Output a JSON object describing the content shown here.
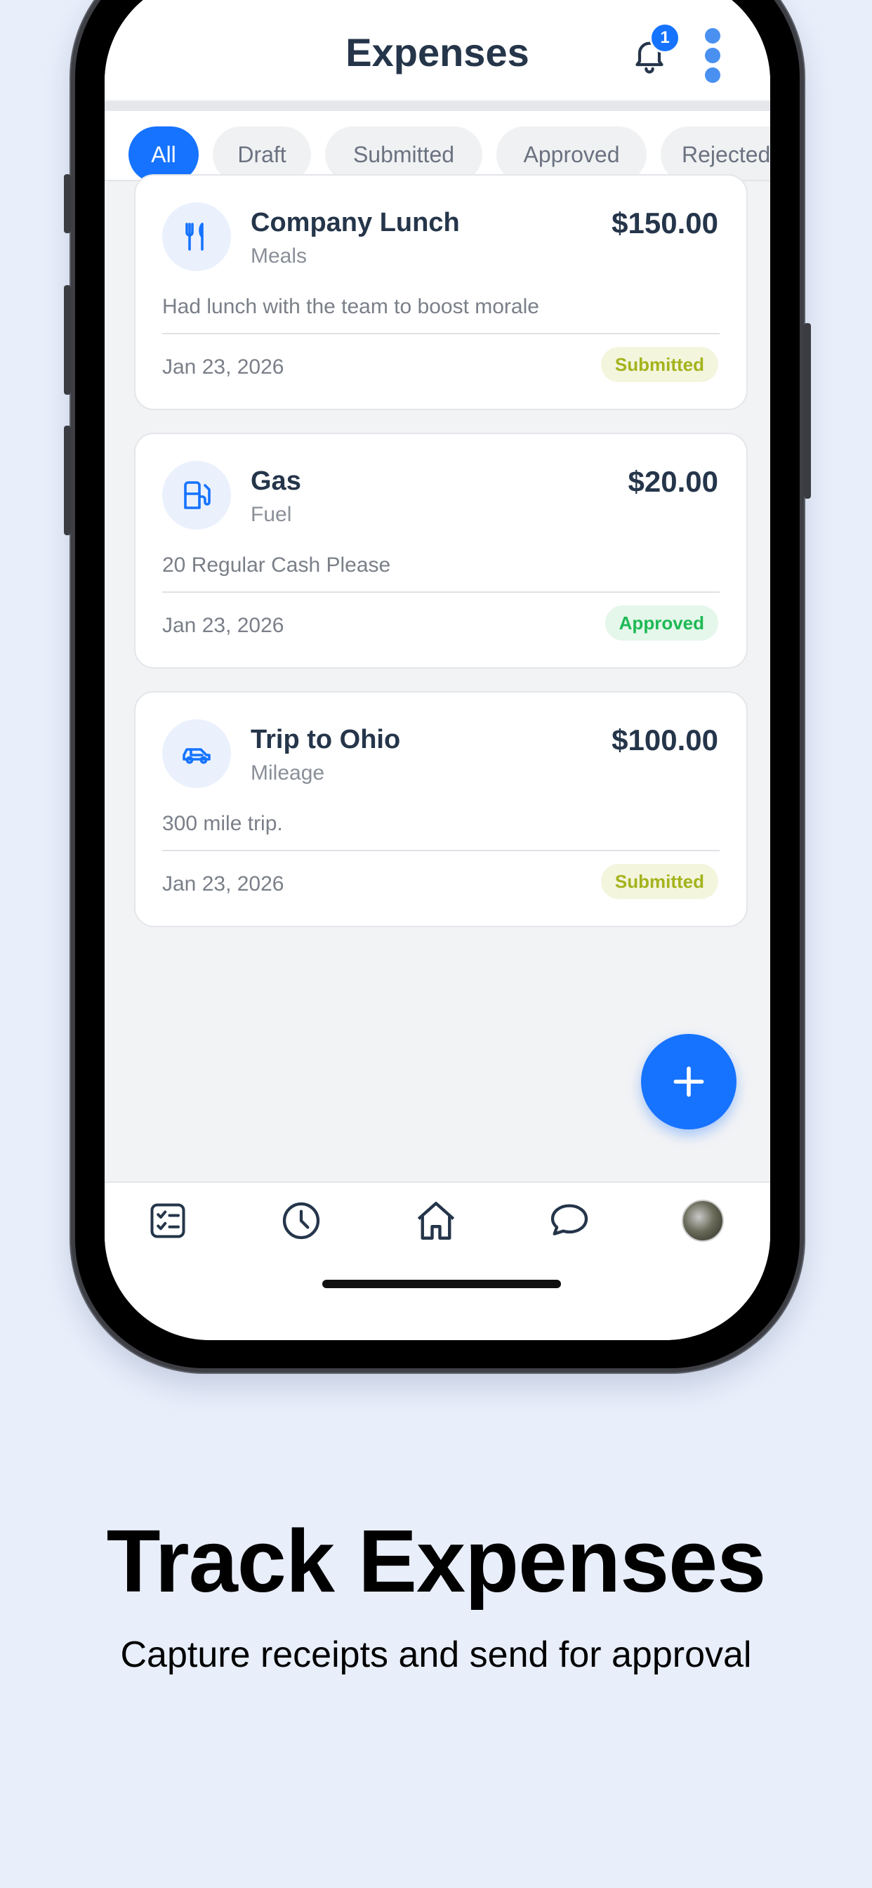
{
  "header": {
    "title": "Expenses",
    "notification_count": "1"
  },
  "filters": [
    {
      "label": "All",
      "active": true
    },
    {
      "label": "Draft"
    },
    {
      "label": "Submitted"
    },
    {
      "label": "Approved"
    },
    {
      "label": "Rejected"
    }
  ],
  "expenses": [
    {
      "title": "Company Lunch",
      "category": "Meals",
      "amount": "$150.00",
      "description": "Had lunch with the team to boost morale",
      "date": "Jan 23, 2026",
      "status": "Submitted",
      "icon": "fork-knife-icon"
    },
    {
      "title": "Gas",
      "category": "Fuel",
      "amount": "$20.00",
      "description": "20 Regular Cash Please",
      "date": "Jan 23, 2026",
      "status": "Approved",
      "icon": "fuel-pump-icon"
    },
    {
      "title": "Trip to Ohio",
      "category": "Mileage",
      "amount": "$100.00",
      "description": "300 mile trip.",
      "date": "Jan 23, 2026",
      "status": "Submitted",
      "icon": "car-icon"
    }
  ],
  "bottom_nav": [
    "checklist-icon",
    "clock-icon",
    "home-icon",
    "chat-icon",
    "avatar"
  ],
  "marketing": {
    "headline": "Track Expenses",
    "subline": "Capture receipts and send for approval"
  },
  "colors": {
    "accent": "#1673ff",
    "submitted": "#a4b31c",
    "approved": "#1eb955",
    "background": "#e8eefa"
  }
}
